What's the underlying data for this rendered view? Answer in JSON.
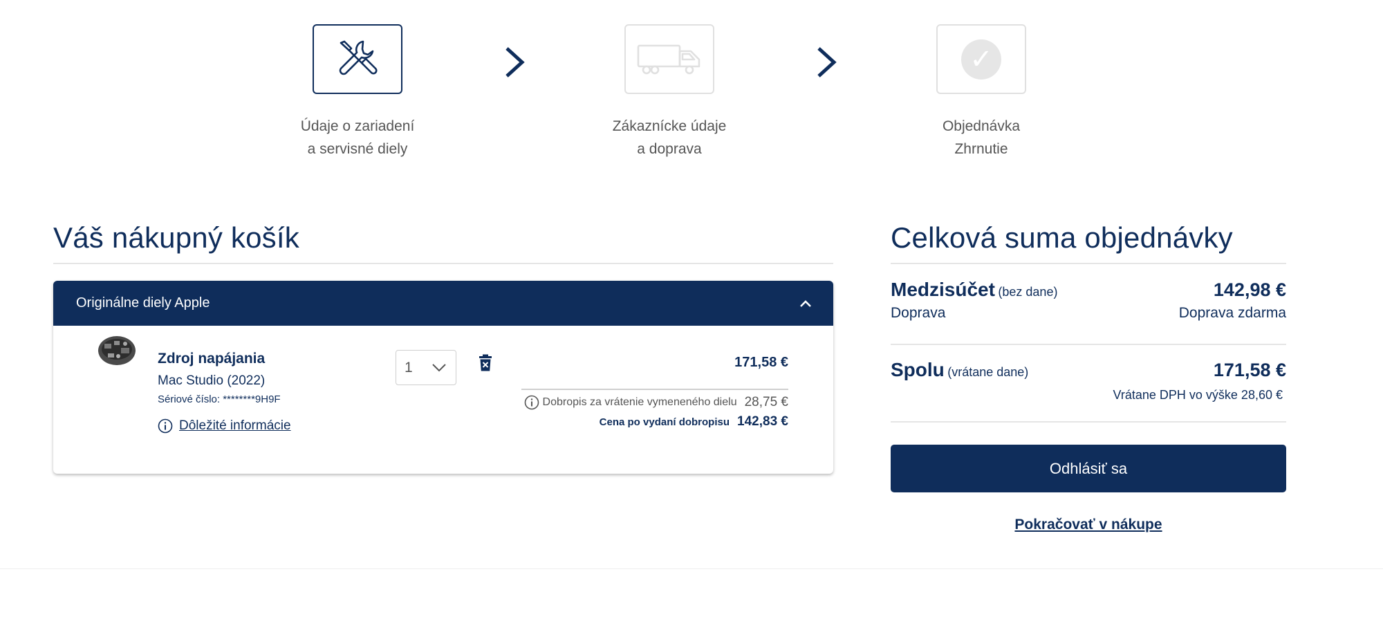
{
  "stepper": {
    "steps": [
      {
        "line1": "Údaje o zariadení",
        "line2": "a servisné diely",
        "icon": "tools-icon",
        "active": true
      },
      {
        "line1": "Zákaznícke údaje",
        "line2": "a doprava",
        "icon": "truck-icon",
        "active": false
      },
      {
        "line1": "Objednávka",
        "line2": "Zhrnutie",
        "icon": "check-icon",
        "active": false
      }
    ]
  },
  "cart": {
    "title": "Váš nákupný košík",
    "group_header": "Originálne diely Apple",
    "item": {
      "name": "Zdroj napájania",
      "model": "Mac Studio (2022)",
      "serial": "Sériové číslo: ********9H9F",
      "info_link": "Dôležité informácie",
      "quantity": "1",
      "price": "171,58 €",
      "credit_label": "Dobropis za vrátenie vymeneného dielu",
      "credit_amount": "28,75 €",
      "after_credit_label": "Cena po vydaní dobropisu",
      "after_credit_amount": "142,83 €"
    }
  },
  "summary": {
    "title": "Celková suma objednávky",
    "subtotal_label": "Medzisúčet",
    "subtotal_note": "(bez dane)",
    "subtotal_amount": "142,98 €",
    "shipping_label": "Doprava",
    "shipping_value": "Doprava zdarma",
    "total_label": "Spolu",
    "total_note": "(vrátane dane)",
    "total_amount": "171,58 €",
    "vat_note": "Vrátane DPH vo výške 28,60 €",
    "checkout_button": "Odhlásiť sa",
    "continue_link": "Pokračovať v nákupe"
  },
  "colors": {
    "brand_navy": "#0f2d5b",
    "inactive_border": "#e0e0e0"
  }
}
